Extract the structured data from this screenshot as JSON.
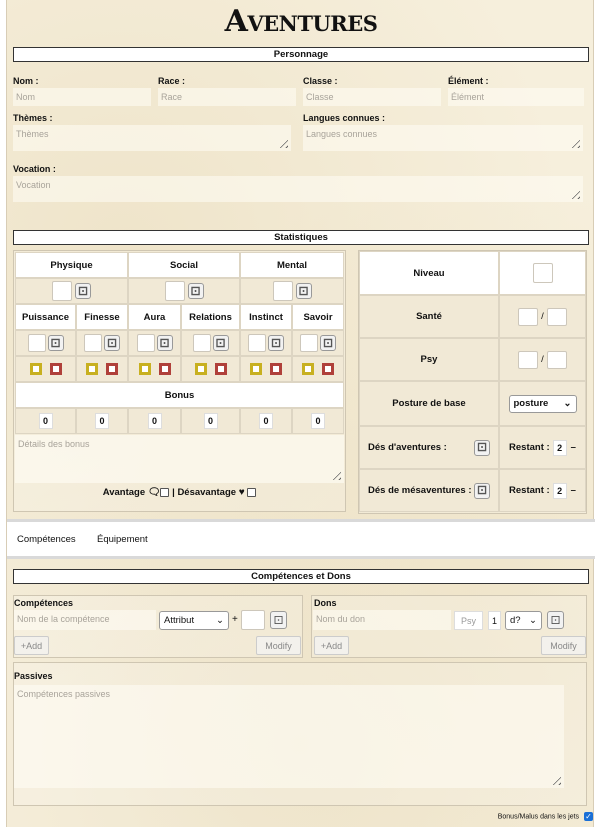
{
  "header": {
    "title_initial": "A",
    "title_rest": "VENTURES"
  },
  "sections": {
    "personnage": "Personnage",
    "statistiques": "Statistiques",
    "competences_dons": "Compétences et Dons"
  },
  "personnage": {
    "nom_label": "Nom :",
    "nom_placeholder": "Nom",
    "race_label": "Race :",
    "race_placeholder": "Race",
    "classe_label": "Classe :",
    "classe_placeholder": "Classe",
    "element_label": "Élément :",
    "element_placeholder": "Élément",
    "themes_label": "Thèmes :",
    "themes_placeholder": "Thèmes",
    "langues_label": "Langues connues :",
    "langues_placeholder": "Langues connues",
    "vocation_label": "Vocation :",
    "vocation_placeholder": "Vocation"
  },
  "stats": {
    "groups": [
      "Physique",
      "Social",
      "Mental"
    ],
    "attributes": [
      "Puissance",
      "Finesse",
      "Aura",
      "Relations",
      "Instinct",
      "Savoir"
    ],
    "bonus_label": "Bonus",
    "bonus_values": [
      "0",
      "0",
      "0",
      "0",
      "0",
      "0"
    ],
    "bonus_details_placeholder": "Détails des bonus",
    "avantage_label": "Avantage",
    "separator": "|",
    "desavantage_label": "Désavantage"
  },
  "right_panel": {
    "niveau_label": "Niveau",
    "sante_label": "Santé",
    "psy_label": "Psy",
    "slash": "/",
    "posture_label": "Posture de base",
    "posture_value": "posture",
    "des_aventures_label": "Dés d'aventures :",
    "des_mesaventures_label": "Dés de mésaventures :",
    "restant_label": "Restant :",
    "restant_aventures_value": "2",
    "restant_mesaventures_value": "2"
  },
  "tabs": [
    "Compétences",
    "Équipement"
  ],
  "competences": {
    "title": "Compétences",
    "name_placeholder": "Nom de la compétence",
    "attribut_value": "Attribut",
    "plus": "+",
    "add_label": "+Add",
    "modify_label": "Modify"
  },
  "dons": {
    "title": "Dons",
    "name_placeholder": "Nom du don",
    "psy_placeholder": "Psy",
    "count_value": "1",
    "dice_value": "d?",
    "add_label": "+Add",
    "modify_label": "Modify"
  },
  "passives": {
    "title": "Passives",
    "placeholder": "Compétences passives"
  },
  "footer": {
    "bonus_malus_label": "Bonus/Malus dans les jets"
  },
  "colors": {
    "parchment": "#f6efdc",
    "yellow_box": "#c8b020",
    "red_box": "#b0403a",
    "checkbox_blue": "#1a6fd6"
  },
  "icons": {
    "dice": "dice-icon",
    "resize": "resize-handle-icon",
    "chevron": "chevron-down-icon",
    "heart": "heart-icon",
    "minus": "minus-icon"
  }
}
